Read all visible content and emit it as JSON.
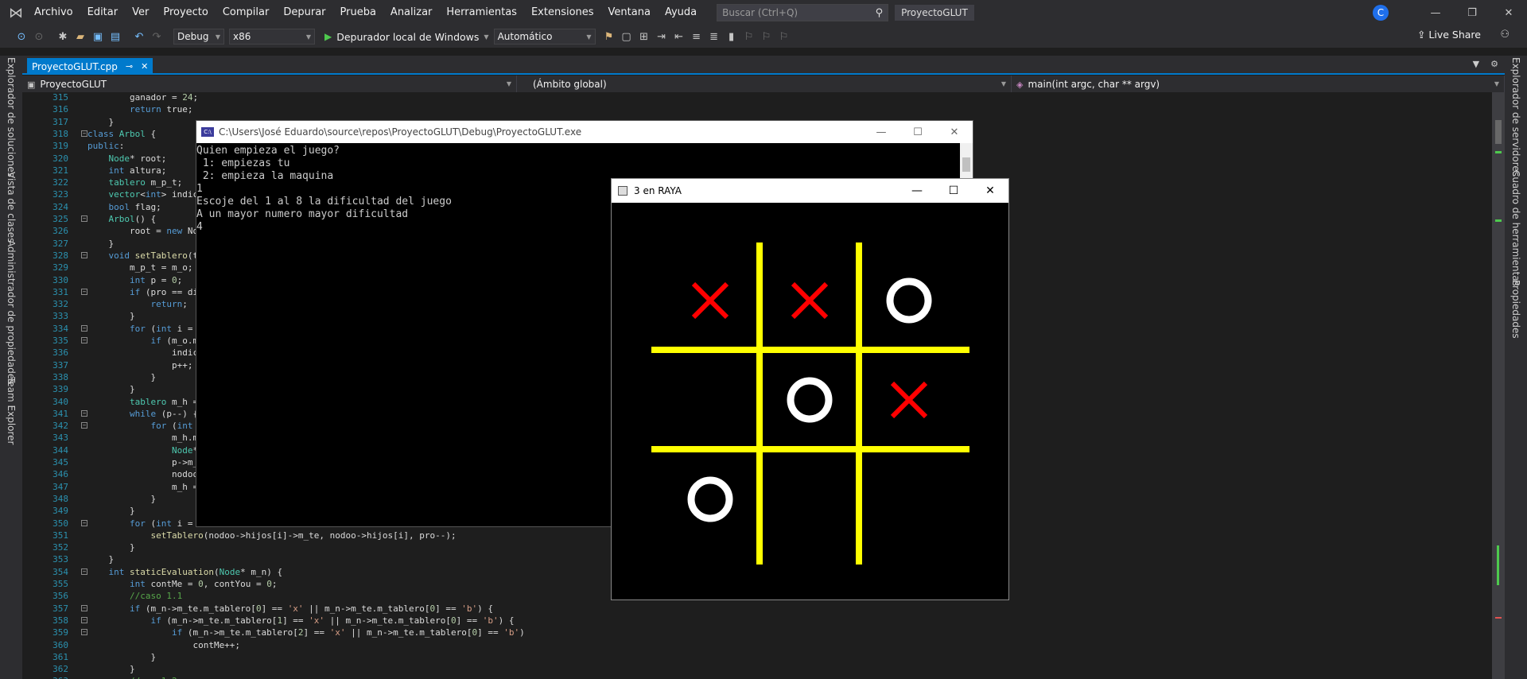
{
  "menubar": {
    "items": [
      "Archivo",
      "Editar",
      "Ver",
      "Proyecto",
      "Compilar",
      "Depurar",
      "Prueba",
      "Analizar",
      "Herramientas",
      "Extensiones",
      "Ventana",
      "Ayuda"
    ],
    "search_placeholder": "Buscar (Ctrl+Q)",
    "project_name": "ProyectoGLUT",
    "account_initial": "C"
  },
  "toolbar": {
    "config": "Debug",
    "platform": "x86",
    "run_label": "Depurador local de Windows",
    "run_mode": "Automático",
    "live_share": "Live Share"
  },
  "left_rail": [
    "Explorador de soluciones",
    "Vista de clases",
    "Administrador de propiedades",
    "Team Explorer"
  ],
  "right_rail": [
    "Explorador de servidores",
    "Cuadro de herramientas",
    "Propiedades"
  ],
  "doc_tab": {
    "name": "ProyectoGLUT.cpp"
  },
  "navbar": {
    "project": "ProyectoGLUT",
    "scope": "(Ámbito global)",
    "member": "main(int argc, char ** argv)"
  },
  "code": {
    "lines": [
      {
        "n": "315",
        "t": "        ganador = 24;"
      },
      {
        "n": "316",
        "t": "        return true;"
      },
      {
        "n": "317",
        "t": "    }"
      },
      {
        "n": "318",
        "t": "class Arbol {"
      },
      {
        "n": "319",
        "t": "public:"
      },
      {
        "n": "320",
        "t": "    Node* root;"
      },
      {
        "n": "321",
        "t": "    int altura;"
      },
      {
        "n": "322",
        "t": "    tablero m_p_t;"
      },
      {
        "n": "323",
        "t": "    vector<int> indic"
      },
      {
        "n": "324",
        "t": "    bool flag;"
      },
      {
        "n": "325",
        "t": "    Arbol() {"
      },
      {
        "n": "326",
        "t": "        root = new No"
      },
      {
        "n": "327",
        "t": "    }"
      },
      {
        "n": "328",
        "t": "    void setTablero(t"
      },
      {
        "n": "329",
        "t": "        m_p_t = m_o;"
      },
      {
        "n": "330",
        "t": "        int p = 0;"
      },
      {
        "n": "331",
        "t": "        if (pro == di"
      },
      {
        "n": "332",
        "t": "            return;"
      },
      {
        "n": "333",
        "t": "        }"
      },
      {
        "n": "334",
        "t": "        for (int i ="
      },
      {
        "n": "335",
        "t": "            if (m_o.m"
      },
      {
        "n": "336",
        "t": "                indic"
      },
      {
        "n": "337",
        "t": "                p++;"
      },
      {
        "n": "338",
        "t": "            }"
      },
      {
        "n": "339",
        "t": "        }"
      },
      {
        "n": "340",
        "t": "        tablero m_h ="
      },
      {
        "n": "341",
        "t": "        while (p--) {"
      },
      {
        "n": "342",
        "t": "            for (int"
      },
      {
        "n": "343",
        "t": "                m_h.m"
      },
      {
        "n": "344",
        "t": "                Node*"
      },
      {
        "n": "345",
        "t": "                p->m_"
      },
      {
        "n": "346",
        "t": "                nodoo"
      },
      {
        "n": "347",
        "t": "                m_h ="
      },
      {
        "n": "348",
        "t": "            }"
      },
      {
        "n": "349",
        "t": "        }"
      },
      {
        "n": "350",
        "t": "        for (int i ="
      },
      {
        "n": "351",
        "t": "            setTablero(nodoo->hijos[i]->m_te, nodoo->hijos[i], pro--);"
      },
      {
        "n": "352",
        "t": "        }"
      },
      {
        "n": "353",
        "t": "    }"
      },
      {
        "n": "354",
        "t": "    int staticEvaluation(Node* m_n) {"
      },
      {
        "n": "355",
        "t": "        int contMe = 0, contYou = 0;"
      },
      {
        "n": "356",
        "t": "        //caso 1.1"
      },
      {
        "n": "357",
        "t": "        if (m_n->m_te.m_tablero[0] == 'x' || m_n->m_te.m_tablero[0] == 'b') {"
      },
      {
        "n": "358",
        "t": "            if (m_n->m_te.m_tablero[1] == 'x' || m_n->m_te.m_tablero[0] == 'b') {"
      },
      {
        "n": "359",
        "t": "                if (m_n->m_te.m_tablero[2] == 'x' || m_n->m_te.m_tablero[0] == 'b')"
      },
      {
        "n": "360",
        "t": "                    contMe++;"
      },
      {
        "n": "361",
        "t": "            }"
      },
      {
        "n": "362",
        "t": "        }"
      },
      {
        "n": "363",
        "t": "        //caso1.2"
      }
    ]
  },
  "console": {
    "title": "C:\\Users\\José Eduardo\\source\\repos\\ProyectoGLUT\\Debug\\ProyectoGLUT.exe",
    "output": "Quien empieza el juego?\n 1: empiezas tu\n 2: empieza la maquina\n1\nEscoje del 1 al 8 la dificultad del juego\nA un mayor numero mayor dificultad\n4"
  },
  "glut": {
    "title": "3 en RAYA",
    "board": [
      "X",
      "X",
      "O",
      "",
      "O",
      "X",
      "O",
      "",
      ""
    ],
    "colors": {
      "grid": "#ffff00",
      "x": "#ff0000",
      "o": "#ffffff",
      "background": "#000000"
    }
  }
}
